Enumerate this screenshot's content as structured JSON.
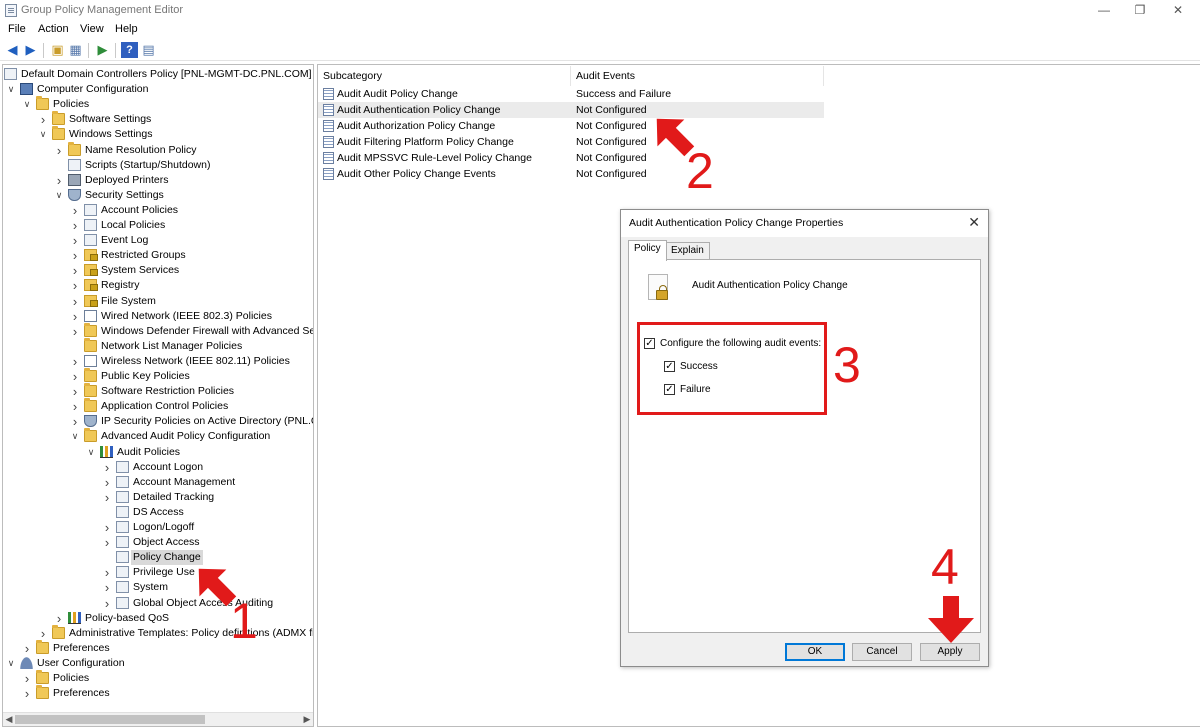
{
  "window": {
    "title": "Group Policy Management Editor"
  },
  "menu": [
    "File",
    "Action",
    "View",
    "Help"
  ],
  "tree": {
    "items": [
      {
        "label": "Default Domain Controllers Policy [PNL-MGMT-DC.PNL.COM] Po",
        "indent": 0,
        "icon": "doc"
      },
      {
        "label": "Computer Configuration",
        "indent": 1,
        "icon": "computer",
        "chev": "open"
      },
      {
        "label": "Policies",
        "indent": 2,
        "icon": "folder",
        "chev": "open"
      },
      {
        "label": "Software Settings",
        "indent": 3,
        "icon": "folder",
        "chev": "closed"
      },
      {
        "label": "Windows Settings",
        "indent": 3,
        "icon": "folder",
        "chev": "open"
      },
      {
        "label": "Name Resolution Policy",
        "indent": 4,
        "icon": "folder",
        "chev": "closed"
      },
      {
        "label": "Scripts (Startup/Shutdown)",
        "indent": 4,
        "icon": "doc"
      },
      {
        "label": "Deployed Printers",
        "indent": 4,
        "icon": "printer",
        "chev": "closed"
      },
      {
        "label": "Security Settings",
        "indent": 4,
        "icon": "shield",
        "chev": "open"
      },
      {
        "label": "Account Policies",
        "indent": 5,
        "icon": "doc",
        "chev": "closed"
      },
      {
        "label": "Local Policies",
        "indent": 5,
        "icon": "doc",
        "chev": "closed"
      },
      {
        "label": "Event Log",
        "indent": 5,
        "icon": "doc",
        "chev": "closed"
      },
      {
        "label": "Restricted Groups",
        "indent": 5,
        "icon": "lockfolder",
        "chev": "closed"
      },
      {
        "label": "System Services",
        "indent": 5,
        "icon": "lockfolder",
        "chev": "closed"
      },
      {
        "label": "Registry",
        "indent": 5,
        "icon": "lockfolder",
        "chev": "closed"
      },
      {
        "label": "File System",
        "indent": 5,
        "icon": "lockfolder",
        "chev": "closed"
      },
      {
        "label": "Wired Network (IEEE 802.3) Policies",
        "indent": 5,
        "icon": "net",
        "chev": "closed"
      },
      {
        "label": "Windows Defender Firewall with Advanced Secu",
        "indent": 5,
        "icon": "folder",
        "chev": "closed"
      },
      {
        "label": "Network List Manager Policies",
        "indent": 5,
        "icon": "folder"
      },
      {
        "label": "Wireless Network (IEEE 802.11) Policies",
        "indent": 5,
        "icon": "net",
        "chev": "closed"
      },
      {
        "label": "Public Key Policies",
        "indent": 5,
        "icon": "folder",
        "chev": "closed"
      },
      {
        "label": "Software Restriction Policies",
        "indent": 5,
        "icon": "folder",
        "chev": "closed"
      },
      {
        "label": "Application Control Policies",
        "indent": 5,
        "icon": "folder",
        "chev": "closed"
      },
      {
        "label": "IP Security Policies on Active Directory (PNL.CO",
        "indent": 5,
        "icon": "shield",
        "chev": "closed"
      },
      {
        "label": "Advanced Audit Policy Configuration",
        "indent": 5,
        "icon": "folder",
        "chev": "open"
      },
      {
        "label": "Audit Policies",
        "indent": 6,
        "icon": "chart",
        "chev": "open"
      },
      {
        "label": "Account Logon",
        "indent": 7,
        "icon": "doc",
        "chev": "closed"
      },
      {
        "label": "Account Management",
        "indent": 7,
        "icon": "doc",
        "chev": "closed"
      },
      {
        "label": "Detailed Tracking",
        "indent": 7,
        "icon": "doc",
        "chev": "closed"
      },
      {
        "label": "DS Access",
        "indent": 7,
        "icon": "doc"
      },
      {
        "label": "Logon/Logoff",
        "indent": 7,
        "icon": "doc",
        "chev": "closed"
      },
      {
        "label": "Object Access",
        "indent": 7,
        "icon": "doc",
        "chev": "closed"
      },
      {
        "label": "Policy Change",
        "indent": 7,
        "icon": "doc",
        "selected": true
      },
      {
        "label": "Privilege Use",
        "indent": 7,
        "icon": "doc",
        "chev": "closed"
      },
      {
        "label": "System",
        "indent": 7,
        "icon": "doc",
        "chev": "closed"
      },
      {
        "label": "Global Object Access Auditing",
        "indent": 7,
        "icon": "doc",
        "chev": "closed"
      },
      {
        "label": "Policy-based QoS",
        "indent": 4,
        "icon": "chart",
        "chev": "closed"
      },
      {
        "label": "Administrative Templates: Policy definitions (ADMX file",
        "indent": 3,
        "icon": "folder",
        "chev": "closed"
      },
      {
        "label": "Preferences",
        "indent": 2,
        "icon": "folder",
        "chev": "closed"
      },
      {
        "label": "User Configuration",
        "indent": 1,
        "icon": "user",
        "chev": "open"
      },
      {
        "label": "Policies",
        "indent": 2,
        "icon": "folder",
        "chev": "closed"
      },
      {
        "label": "Preferences",
        "indent": 2,
        "icon": "folder",
        "chev": "closed"
      }
    ]
  },
  "list": {
    "headers": [
      "Subcategory",
      "Audit Events"
    ],
    "rows": [
      {
        "subcategory": "Audit Audit Policy Change",
        "events": "Success and Failure"
      },
      {
        "subcategory": "Audit Authentication Policy Change",
        "events": "Not Configured",
        "highlight": true
      },
      {
        "subcategory": "Audit Authorization Policy Change",
        "events": "Not Configured"
      },
      {
        "subcategory": "Audit Filtering Platform Policy Change",
        "events": "Not Configured"
      },
      {
        "subcategory": "Audit MPSSVC Rule-Level Policy Change",
        "events": "Not Configured"
      },
      {
        "subcategory": "Audit Other Policy Change Events",
        "events": "Not Configured"
      }
    ]
  },
  "dialog": {
    "title": "Audit Authentication Policy Change Properties",
    "tabs": [
      "Policy",
      "Explain"
    ],
    "policy_name": "Audit Authentication Policy Change",
    "configure_label": "Configure the following audit events:",
    "success_label": "Success",
    "failure_label": "Failure",
    "configure_checked": true,
    "success_checked": true,
    "failure_checked": true,
    "buttons": {
      "ok": "OK",
      "cancel": "Cancel",
      "apply": "Apply"
    }
  },
  "annotations": {
    "step1": "1",
    "step2": "2",
    "step3": "3",
    "step4": "4",
    "color": "#e11a1a"
  }
}
